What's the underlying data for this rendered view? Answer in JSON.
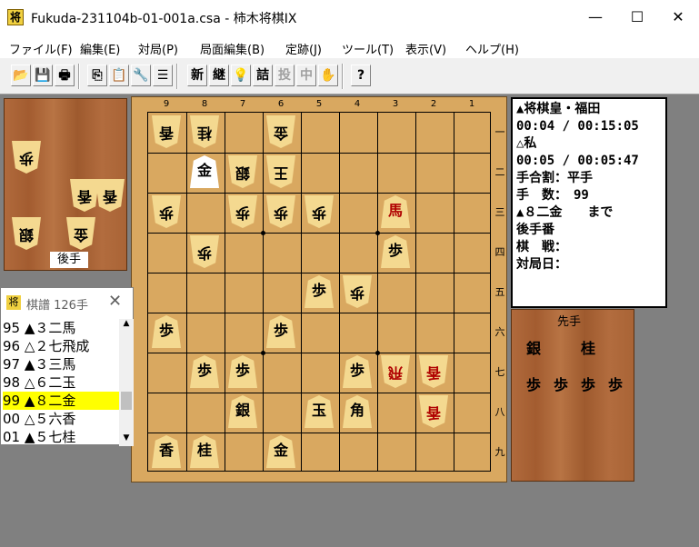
{
  "window": {
    "title": "Fukuda-231104b-01-001a.csa - 柿木将棋IX",
    "icon": "将",
    "minimize": "—",
    "maximize": "☐",
    "close": "✕"
  },
  "menu": [
    "ファイル(F)",
    "編集(E)",
    "対局(P)",
    "局面編集(B)",
    "定跡(J)",
    "ツール(T)",
    "表示(V)",
    "ヘルプ(H)"
  ],
  "toolbar": {
    "new_label": "新",
    "continue_label": "継",
    "hint_label": "💡",
    "tsume_label": "詰",
    "resign_label": "投",
    "interrupt_label": "中",
    "wait_label": "✋",
    "help_label": "?"
  },
  "board": {
    "files": [
      "9",
      "8",
      "7",
      "6",
      "5",
      "4",
      "3",
      "2",
      "1"
    ],
    "ranks": [
      "一",
      "二",
      "三",
      "四",
      "五",
      "六",
      "七",
      "八",
      "九"
    ],
    "pieces": [
      {
        "file": 9,
        "rank": 1,
        "kanji": "香",
        "side": "gote"
      },
      {
        "file": 8,
        "rank": 1,
        "kanji": "桂",
        "side": "gote"
      },
      {
        "file": 6,
        "rank": 1,
        "kanji": "金",
        "side": "gote"
      },
      {
        "file": 8,
        "rank": 2,
        "kanji": "金",
        "side": "sente",
        "highlight": true
      },
      {
        "file": 7,
        "rank": 2,
        "kanji": "銀",
        "side": "gote"
      },
      {
        "file": 6,
        "rank": 2,
        "kanji": "王",
        "side": "gote"
      },
      {
        "file": 9,
        "rank": 3,
        "kanji": "歩",
        "side": "gote"
      },
      {
        "file": 7,
        "rank": 3,
        "kanji": "歩",
        "side": "gote"
      },
      {
        "file": 6,
        "rank": 3,
        "kanji": "歩",
        "side": "gote"
      },
      {
        "file": 5,
        "rank": 3,
        "kanji": "歩",
        "side": "gote"
      },
      {
        "file": 3,
        "rank": 3,
        "kanji": "馬",
        "side": "sente",
        "red": true
      },
      {
        "file": 8,
        "rank": 4,
        "kanji": "歩",
        "side": "gote"
      },
      {
        "file": 3,
        "rank": 4,
        "kanji": "歩",
        "side": "sente"
      },
      {
        "file": 5,
        "rank": 5,
        "kanji": "歩",
        "side": "sente"
      },
      {
        "file": 4,
        "rank": 5,
        "kanji": "歩",
        "side": "gote"
      },
      {
        "file": 9,
        "rank": 6,
        "kanji": "歩",
        "side": "sente"
      },
      {
        "file": 6,
        "rank": 6,
        "kanji": "歩",
        "side": "sente"
      },
      {
        "file": 8,
        "rank": 7,
        "kanji": "歩",
        "side": "sente"
      },
      {
        "file": 7,
        "rank": 7,
        "kanji": "歩",
        "side": "sente"
      },
      {
        "file": 4,
        "rank": 7,
        "kanji": "歩",
        "side": "sente"
      },
      {
        "file": 3,
        "rank": 7,
        "kanji": "飛",
        "side": "gote",
        "red": true
      },
      {
        "file": 2,
        "rank": 7,
        "kanji": "香",
        "side": "gote",
        "red": true
      },
      {
        "file": 7,
        "rank": 8,
        "kanji": "銀",
        "side": "sente"
      },
      {
        "file": 5,
        "rank": 8,
        "kanji": "玉",
        "side": "sente"
      },
      {
        "file": 4,
        "rank": 8,
        "kanji": "角",
        "side": "sente"
      },
      {
        "file": 2,
        "rank": 8,
        "kanji": "香",
        "side": "gote",
        "red": true
      },
      {
        "file": 9,
        "rank": 9,
        "kanji": "香",
        "side": "sente"
      },
      {
        "file": 8,
        "rank": 9,
        "kanji": "桂",
        "side": "sente"
      },
      {
        "file": 6,
        "rank": 9,
        "kanji": "金",
        "side": "sente"
      }
    ]
  },
  "gote_hand": {
    "label": "後手",
    "pieces": [
      "歩",
      "香",
      "香",
      "銀",
      "金"
    ]
  },
  "sente_hand": {
    "label": "先手",
    "pieces": [
      "銀",
      "桂",
      "歩",
      "歩",
      "歩",
      "歩"
    ]
  },
  "info": {
    "line1": "▲将棋皇・福田",
    "line2": "00:04 / 00:15:05",
    "line3": "△私",
    "line4": "00:05 / 00:05:47",
    "line5": "手合割：平手",
    "line6": "手　数：　99",
    "line7": "▲８二金　　まで",
    "line8": "後手番",
    "line9": "棋　戦：",
    "line10": "対局日："
  },
  "kifu": {
    "title": "棋譜 126手",
    "icon": "将",
    "close": "✕",
    "moves": [
      {
        "text": "95 ▲３二馬",
        "selected": false
      },
      {
        "text": "96 △２七飛成",
        "selected": false
      },
      {
        "text": "97 ▲３三馬",
        "selected": false
      },
      {
        "text": "98 △６二玉",
        "selected": false
      },
      {
        "text": "99 ▲８二金",
        "selected": true
      },
      {
        "text": "00 △５六香",
        "selected": false
      },
      {
        "text": "01 ▲５七桂",
        "selected": false
      }
    ]
  }
}
